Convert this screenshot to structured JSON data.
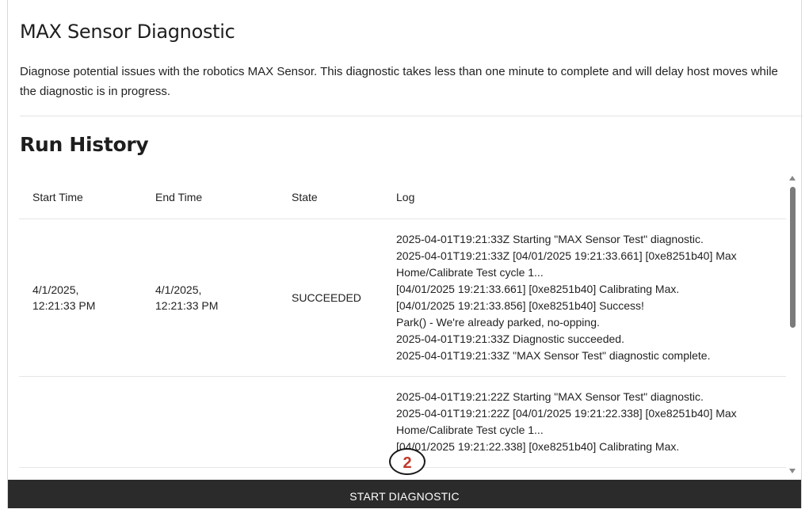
{
  "page": {
    "title": "MAX Sensor Diagnostic",
    "description": "Diagnose potential issues with the robotics MAX Sensor. This diagnostic takes less than one minute to complete and will delay host moves while the diagnostic is in progress."
  },
  "history": {
    "title": "Run History",
    "columns": {
      "start": "Start Time",
      "end": "End Time",
      "state": "State",
      "log": "Log"
    },
    "rows": [
      {
        "start_time": "4/1/2025, 12:21:33 PM",
        "start_date": "4/1/2025,",
        "start_clock": "12:21:33 PM",
        "end_date": "4/1/2025,",
        "end_clock": "12:21:33 PM",
        "state": "SUCCEEDED",
        "log": [
          "2025-04-01T19:21:33Z Starting \"MAX Sensor Test\" diagnostic.",
          "2025-04-01T19:21:33Z [04/01/2025 19:21:33.661] [0xe8251b40] Max Home/Calibrate Test cycle 1...",
          "[04/01/2025 19:21:33.661] [0xe8251b40] Calibrating Max.",
          "[04/01/2025 19:21:33.856] [0xe8251b40] Success!",
          "Park() - We're already parked, no-opping.",
          "2025-04-01T19:21:33Z Diagnostic succeeded.",
          "2025-04-01T19:21:33Z \"MAX Sensor Test\" diagnostic complete."
        ]
      },
      {
        "log": [
          "2025-04-01T19:21:22Z Starting \"MAX Sensor Test\" diagnostic.",
          "2025-04-01T19:21:22Z [04/01/2025 19:21:22.338] [0xe8251b40] Max Home/Calibrate Test cycle 1...",
          "[04/01/2025 19:21:22.338] [0xe8251b40] Calibrating Max."
        ]
      }
    ]
  },
  "actions": {
    "start_label": "START DIAGNOSTIC"
  },
  "annotation": {
    "marker_label": "2"
  },
  "colors": {
    "bar_bg": "#2b2b2b",
    "marker_text": "#c0392b"
  }
}
